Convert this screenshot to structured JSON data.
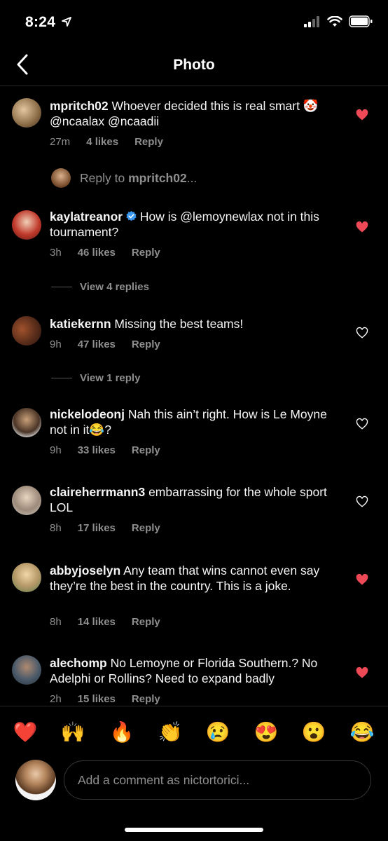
{
  "status_bar": {
    "time": "8:24"
  },
  "nav": {
    "title": "Photo"
  },
  "comments": [
    {
      "user": "mpritch02",
      "text": "Whoever decided this is real smart 🤡 @ncaalax @ncaadii",
      "time": "27m",
      "likes": "4 likes",
      "reply": "Reply",
      "liked": true,
      "verified": false
    },
    {
      "user": "kaylatreanor",
      "text": "How is @lemoynewlax not in this tournament?",
      "time": "3h",
      "likes": "46 likes",
      "reply": "Reply",
      "liked": true,
      "verified": true
    },
    {
      "user": "katiekernn",
      "text": "Missing the best teams!",
      "time": "9h",
      "likes": "47 likes",
      "reply": "Reply",
      "liked": false,
      "verified": false
    },
    {
      "user": "nickelodeonj",
      "text": "Nah this ain’t right. How is Le Moyne not in it😂?",
      "time": "9h",
      "likes": "33 likes",
      "reply": "Reply",
      "liked": false,
      "verified": false
    },
    {
      "user": "claireherrmann3",
      "text": "embarrassing for the whole sport LOL",
      "time": "8h",
      "likes": "17 likes",
      "reply": "Reply",
      "liked": false,
      "verified": false
    },
    {
      "user": "abbyjoselyn",
      "text": "Any team that wins cannot even say they’re the best in the country. This is a joke.",
      "time": "8h",
      "likes": "14 likes",
      "reply": "Reply",
      "liked": true,
      "verified": false
    },
    {
      "user": "alechomp",
      "text": "No Lemoyne or Florida Southern.? No Adelphi or Rollins?  Need to expand badly",
      "time": "2h",
      "likes": "15 likes",
      "reply": "Reply",
      "liked": true,
      "verified": false
    }
  ],
  "reply_prompt": {
    "prefix": "Reply to ",
    "user": "mpritch02",
    "suffix": "..."
  },
  "view_replies": [
    "View 4 replies",
    "View 1 reply"
  ],
  "emoji_bar": [
    "❤️",
    "🙌",
    "🔥",
    "👏",
    "😢",
    "😍",
    "😮",
    "😂"
  ],
  "comment_input": {
    "placeholder": "Add a comment as nictortorici..."
  },
  "colors": {
    "liked_heart": "#ed4956",
    "muted_text": "#8e8e8e",
    "verified": "#3897f0"
  }
}
